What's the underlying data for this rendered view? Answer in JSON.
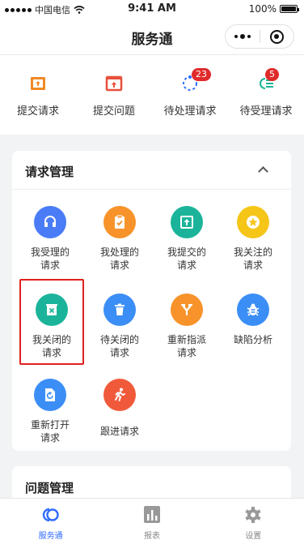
{
  "status_bar": {
    "carrier": "中国电信",
    "time": "9:41 AM",
    "battery": "100%"
  },
  "nav": {
    "title": "服务通"
  },
  "quick_actions": [
    {
      "label": "提交请求",
      "icon": "upload-box-icon",
      "color": "#f08a24"
    },
    {
      "label": "提交问题",
      "icon": "upload-doc-icon",
      "color": "#e8503a"
    },
    {
      "label": "待处理请求",
      "icon": "loading-spinner-icon",
      "color": "#2f6bff",
      "badge": "23"
    },
    {
      "label": "待受理请求",
      "icon": "list-refresh-icon",
      "color": "#19b394",
      "badge": "5"
    }
  ],
  "request_card": {
    "title": "请求管理",
    "items": [
      {
        "label": "我受理的\n请求",
        "color": "#4a7cf7",
        "icon": "headset-icon"
      },
      {
        "label": "我处理的\n请求",
        "color": "#f7932a",
        "icon": "clipboard-check-icon"
      },
      {
        "label": "我提交的\n请求",
        "color": "#1bb49a",
        "icon": "submit-icon"
      },
      {
        "label": "我关注的\n请求",
        "color": "#f5c518",
        "icon": "star-icon"
      },
      {
        "label": "我关闭的\n请求",
        "color": "#1bb49a",
        "icon": "close-box-icon"
      },
      {
        "label": "待关闭的\n请求",
        "color": "#3b8ef5",
        "icon": "trash-icon"
      },
      {
        "label": "重新指派\n请求",
        "color": "#f7932a",
        "icon": "fork-icon"
      },
      {
        "label": "缺陷分析",
        "color": "#3b8ef5",
        "icon": "bug-icon"
      },
      {
        "label": "重新打开\n请求",
        "color": "#3b8ef5",
        "icon": "reopen-doc-icon"
      },
      {
        "label": "跟进请求",
        "color": "#f05a3a",
        "icon": "runner-icon"
      }
    ]
  },
  "problem_card": {
    "title": "问题管理"
  },
  "tabs": [
    {
      "label": "服务通",
      "icon": "service-logo-icon",
      "active": true
    },
    {
      "label": "报表",
      "icon": "chart-icon",
      "active": false
    },
    {
      "label": "设置",
      "icon": "gear-icon",
      "active": false
    }
  ]
}
